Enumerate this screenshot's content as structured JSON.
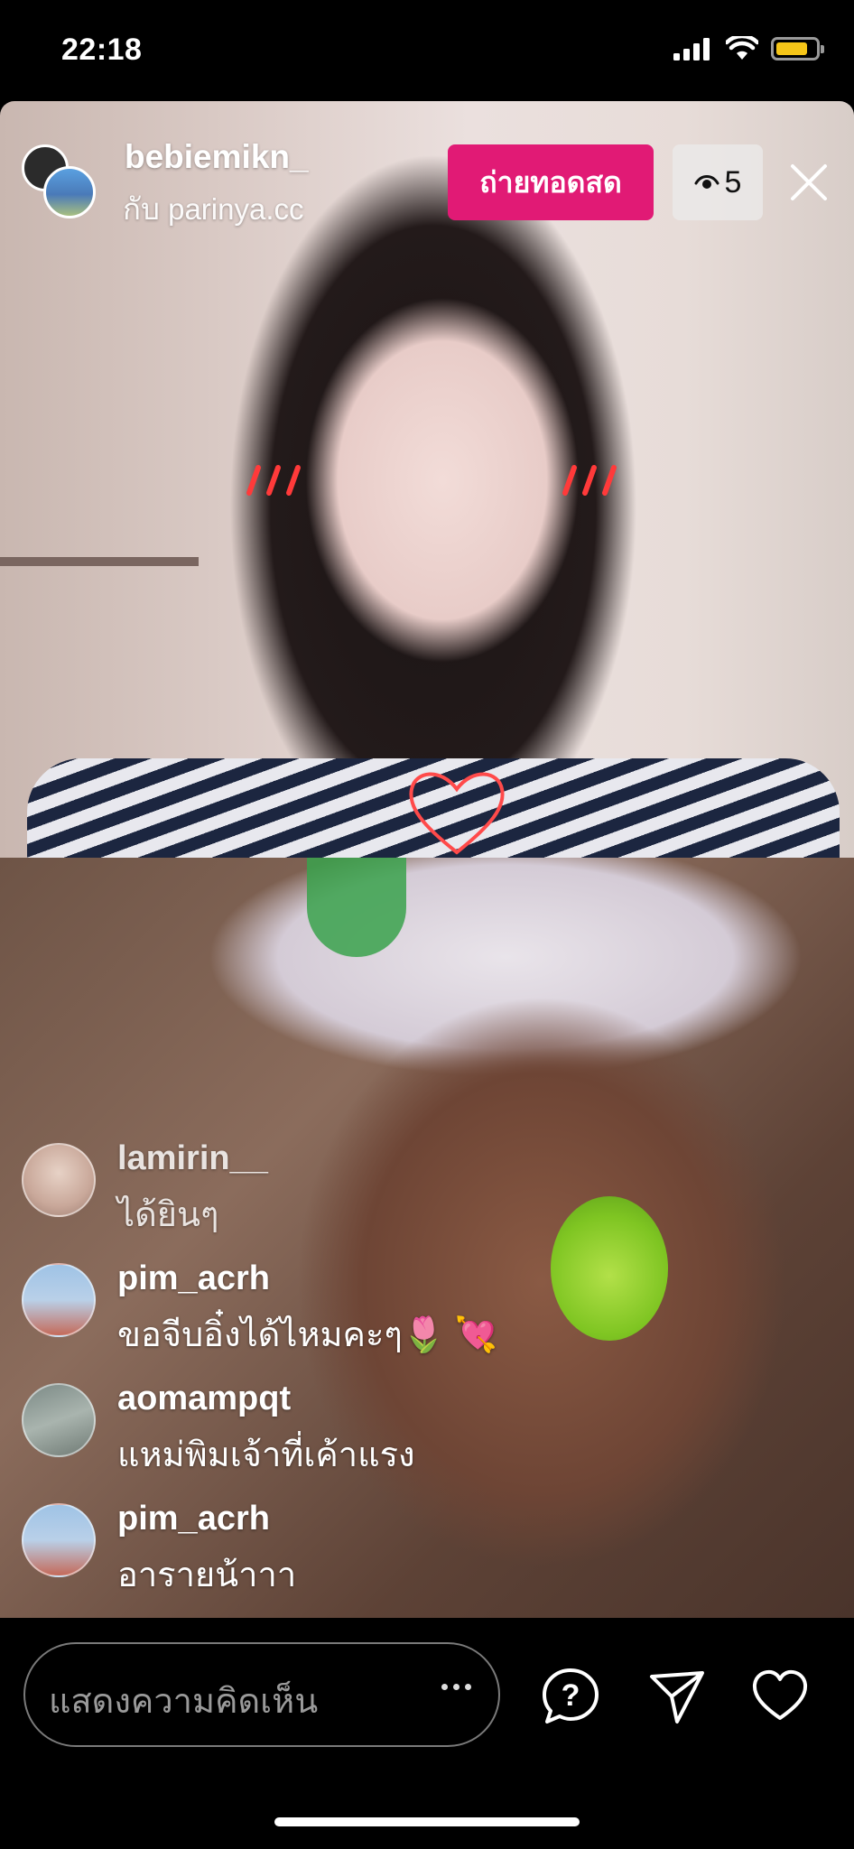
{
  "status_bar": {
    "time": "22:18",
    "icons": [
      "cellular-signal-icon",
      "wifi-icon",
      "battery-icon"
    ],
    "battery_color": "#f5c518"
  },
  "header": {
    "host_username": "bebiemikn_",
    "guest_line": "กับ parinya.cc",
    "live_label": "ถ่ายทอดสด",
    "live_color": "#e11a75",
    "viewer_count": "5"
  },
  "comments": [
    {
      "username": "lamirin__",
      "text": "ได้ยินๆ",
      "avatar_color": "#c9a89a"
    },
    {
      "username": "pim_acrh",
      "text": "ขอจีบอิ๋งได้ไหมคะๆ🌷 💘",
      "avatar_color": "#9fb9d8"
    },
    {
      "username": "aomampqt",
      "text": "แหม่พิมเจ้าที่เค้าแรง",
      "avatar_color": "#8a8a80"
    },
    {
      "username": "pim_acrh",
      "text": "อารายน้าาา",
      "avatar_color": "#9fb9d8"
    }
  ],
  "footer": {
    "comment_placeholder": "แสดงความคิดเห็น",
    "actions": [
      "question-icon",
      "send-icon",
      "heart-icon"
    ]
  }
}
